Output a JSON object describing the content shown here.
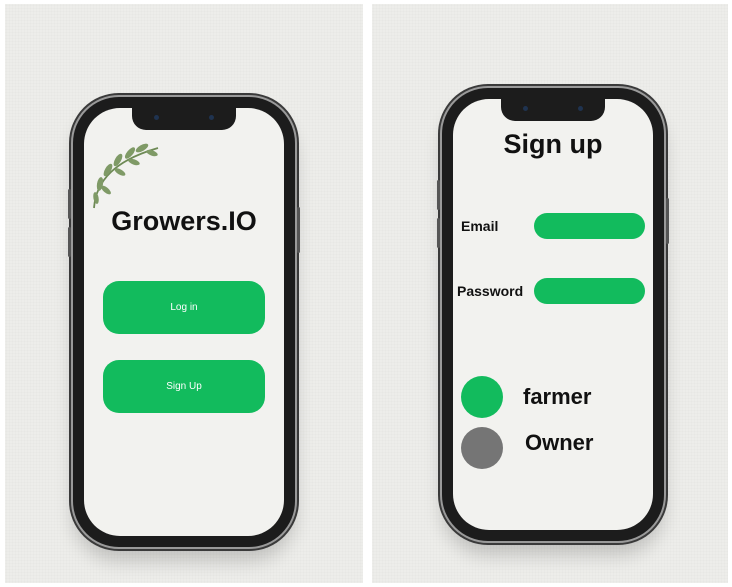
{
  "login_screen": {
    "title": "Growers.IO",
    "login_button": "Log in",
    "signup_button": "Sign Up",
    "decoration_icon": "leaf-branch-icon"
  },
  "signup_screen": {
    "title": "Sign up",
    "email_label": "Email",
    "email_value": "",
    "password_label": "Password",
    "password_value": "",
    "roles": [
      {
        "label": "farmer",
        "selected": true,
        "color": "#12bb5d"
      },
      {
        "label": "Owner",
        "selected": false,
        "color": "#757575"
      }
    ]
  },
  "colors": {
    "accent": "#12bb5d",
    "background": "#ededea",
    "screen": "#f2f2ef"
  }
}
